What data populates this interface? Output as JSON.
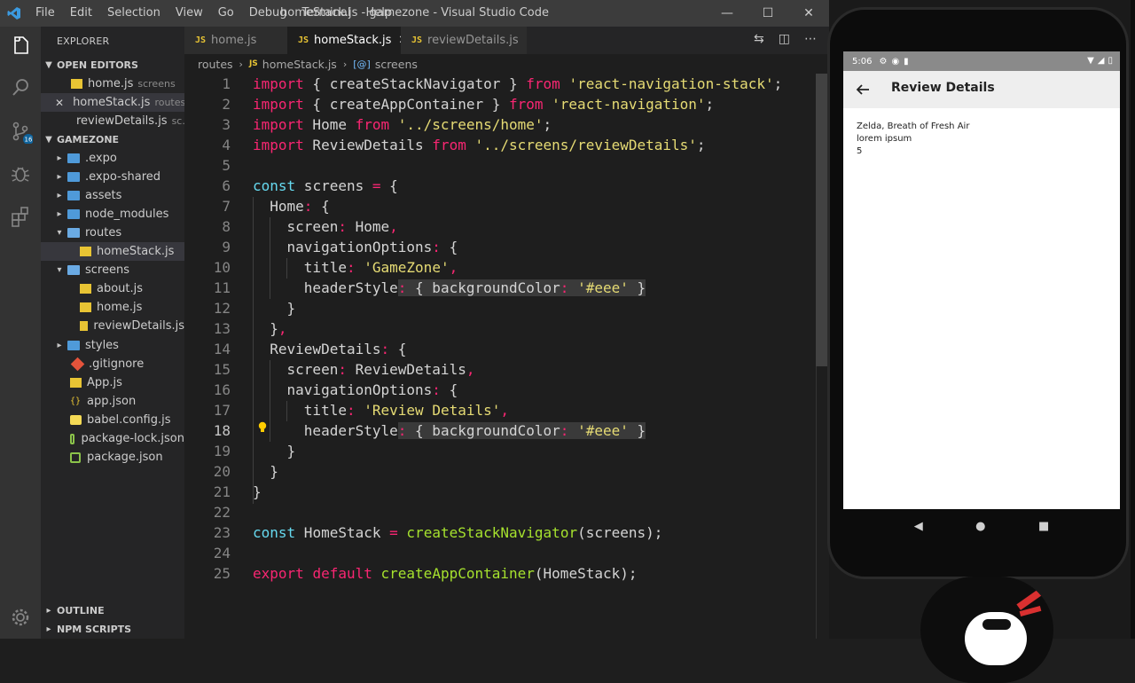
{
  "window": {
    "title": "homeStack.js - gamezone - Visual Studio Code",
    "menu": [
      "File",
      "Edit",
      "Selection",
      "View",
      "Go",
      "Debug",
      "Terminal",
      "Help"
    ]
  },
  "activity_bar": {
    "scm_badge": "16"
  },
  "sidebar": {
    "title": "EXPLORER",
    "open_editors_label": "OPEN EDITORS",
    "open_editors": [
      {
        "name": "home.js",
        "hint": "screens"
      },
      {
        "name": "homeStack.js",
        "hint": "routes"
      },
      {
        "name": "reviewDetails.js",
        "hint": "sc..."
      }
    ],
    "project_label": "GAMEZONE",
    "tree": [
      {
        "name": ".expo",
        "type": "folder"
      },
      {
        "name": ".expo-shared",
        "type": "folder"
      },
      {
        "name": "assets",
        "type": "folder"
      },
      {
        "name": "node_modules",
        "type": "folder"
      },
      {
        "name": "routes",
        "type": "folder-open"
      },
      {
        "name": "homeStack.js",
        "type": "js"
      },
      {
        "name": "screens",
        "type": "folder-open"
      },
      {
        "name": "about.js",
        "type": "js"
      },
      {
        "name": "home.js",
        "type": "js"
      },
      {
        "name": "reviewDetails.js",
        "type": "js"
      },
      {
        "name": "styles",
        "type": "folder"
      },
      {
        "name": ".gitignore",
        "type": "git"
      },
      {
        "name": "App.js",
        "type": "js"
      },
      {
        "name": "app.json",
        "type": "json"
      },
      {
        "name": "babel.config.js",
        "type": "babel"
      },
      {
        "name": "package-lock.json",
        "type": "npm"
      },
      {
        "name": "package.json",
        "type": "npm"
      }
    ],
    "outline_label": "OUTLINE",
    "npm_label": "NPM SCRIPTS"
  },
  "tabs": [
    {
      "label": "home.js"
    },
    {
      "label": "homeStack.js"
    },
    {
      "label": "reviewDetails.js"
    }
  ],
  "breadcrumb": {
    "folder": "routes",
    "file": "homeStack.js",
    "symbol": "screens"
  },
  "editor": {
    "current_line": 18,
    "line_numbers": [
      "1",
      "2",
      "3",
      "4",
      "5",
      "6",
      "7",
      "8",
      "9",
      "10",
      "11",
      "12",
      "13",
      "14",
      "15",
      "16",
      "17",
      "18",
      "19",
      "20",
      "21",
      "22",
      "23",
      "24",
      "25"
    ],
    "code_text": [
      "import { createStackNavigator } from 'react-navigation-stack';",
      "import { createAppContainer } from 'react-navigation';",
      "import Home from '../screens/home';",
      "import ReviewDetails from '../screens/reviewDetails';",
      "",
      "const screens = {",
      "  Home: {",
      "    screen: Home,",
      "    navigationOptions: {",
      "      title: 'GameZone',",
      "      headerStyle: { backgroundColor: '#eee' }",
      "    }",
      "  },",
      "  ReviewDetails: {",
      "    screen: ReviewDetails,",
      "    navigationOptions: {",
      "      title: 'Review Details',",
      "      headerStyle: { backgroundColor: '#eee' }",
      "    }",
      "  }",
      "}",
      "",
      "const HomeStack = createStackNavigator(screens);",
      "",
      "export default createAppContainer(HomeStack);"
    ]
  },
  "phone": {
    "time": "5:06",
    "header_title": "Review Details",
    "content": [
      "Zelda, Breath of Fresh Air",
      "lorem ipsum",
      "5"
    ]
  },
  "colors": {
    "keyword": "#f92672",
    "storage": "#66d9ef",
    "string": "#e6db74",
    "function": "#a6e22e",
    "editor_bg": "#1e1e1e",
    "sidebar_bg": "#252526",
    "header_bg": "#eeeeee"
  }
}
